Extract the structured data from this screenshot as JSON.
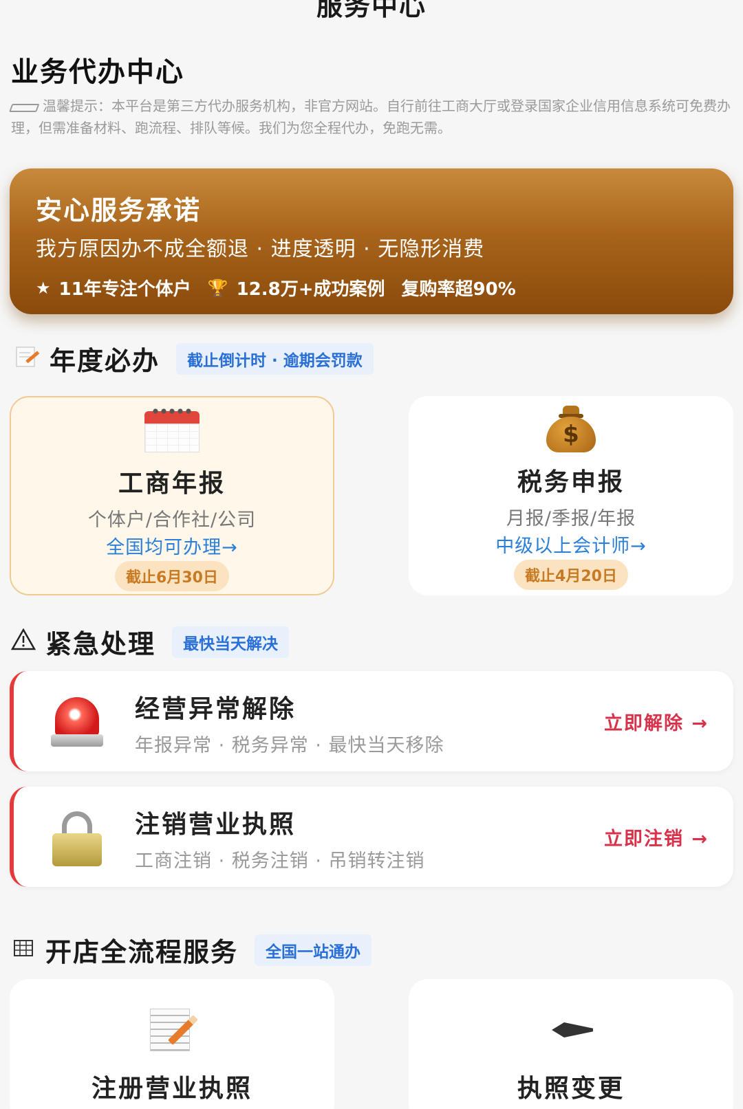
{
  "header": {
    "title": "服务中心"
  },
  "agency": {
    "title": "业务代办中心",
    "notice": "温馨提示：本平台是第三方代办服务机构，非官方网站。自行前往工商大厅或登录国家企业信用信息系统可免费办理，但需准备材料、跑流程、排队等候。我们为您全程代办，免跑无需。"
  },
  "promise": {
    "title": "安心服务承诺",
    "subtitle": "我方原因办不成全额退 · 进度透明 · 无隐形消费",
    "stats": [
      {
        "icon": "star-icon",
        "glyph": "★",
        "text": "11年专注个体户"
      },
      {
        "icon": "trophy-icon",
        "glyph": "🏆",
        "text": "12.8万+成功案例"
      },
      {
        "icon": "",
        "glyph": "",
        "text": "复购率超90%"
      }
    ]
  },
  "annual": {
    "icon": "memo-icon",
    "title": "年度必办",
    "tag": "截止倒计时 · 逾期会罚款",
    "cards": [
      {
        "icon": "calendar-icon",
        "title": "工商年报",
        "subtitle": "个体户/合作社/公司",
        "link": "全国均可办理→",
        "deadline": "截止6月30日"
      },
      {
        "icon": "money-bag-icon",
        "title": "税务申报",
        "subtitle": "月报/季报/年报",
        "link": "中级以上会计师→",
        "deadline": "截止4月20日"
      }
    ]
  },
  "urgent": {
    "icon": "warning-icon",
    "title": "紧急处理",
    "tag": "最快当天解决",
    "items": [
      {
        "icon": "siren-icon",
        "title": "经营异常解除",
        "subtitle": "年报异常 · 税务异常 · 最快当天移除",
        "action": "立即解除 →"
      },
      {
        "icon": "lock-icon",
        "title": "注销营业执照",
        "subtitle": "工商注销 · 税务注销 · 吊销转注销",
        "action": "立即注销 →"
      }
    ]
  },
  "shop": {
    "icon": "grid-icon",
    "title": "开店全流程服务",
    "tag": "全国一站通办",
    "cards": [
      {
        "icon": "memo-pencil-icon",
        "title": "注册营业执照"
      },
      {
        "icon": "fountain-pen-icon",
        "title": "执照变更"
      }
    ]
  },
  "colors": {
    "accent_blue": "#2a6fd6",
    "alert_red": "#e33b3b",
    "promise_brown": "#8a4a0c"
  }
}
